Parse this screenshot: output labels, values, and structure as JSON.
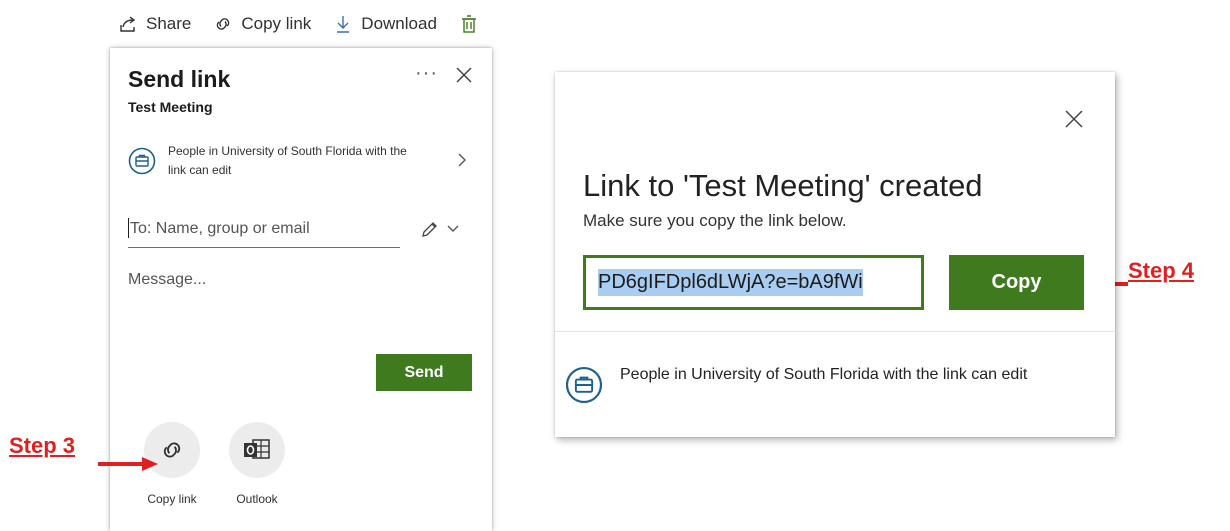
{
  "toolbar": {
    "share_label": "Share",
    "copy_link_label": "Copy link",
    "download_label": "Download"
  },
  "send_panel": {
    "title": "Send link",
    "file_name": "Test Meeting",
    "more_label": "···",
    "permission_text": "People in University of South Florida with the link can edit",
    "to_placeholder": "To: Name, group or email",
    "message_placeholder": "Message...",
    "send_label": "Send",
    "share_options": [
      {
        "label": "Copy link"
      },
      {
        "label": "Outlook"
      }
    ]
  },
  "annotations": {
    "step3": "Step 3",
    "step4": "Step 4",
    "arrow_color": "#e02020"
  },
  "link_dialog": {
    "title": "Link to 'Test Meeting' created",
    "subtitle": "Make sure you copy the link below.",
    "link_value": "PD6gIFDpl6dLWjA?e=bA9fWi",
    "copy_label": "Copy",
    "permission_text": "People in University of South Florida with the link can edit"
  },
  "colors": {
    "brand_green": "#3f7a1f",
    "selection_blue": "#a9cdf1",
    "icon_blue": "#1f5f8b"
  }
}
